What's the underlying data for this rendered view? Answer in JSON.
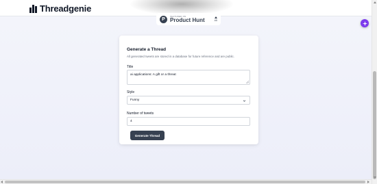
{
  "header": {
    "brand_name": "Threadgenie",
    "brand_icon": "bars-logo-icon"
  },
  "product_hunt_badge": {
    "small_text": "FEATURED ON",
    "name": "Product Hunt",
    "logo_letter": "P",
    "votes": "40",
    "icon": "upvote-arrow-icon"
  },
  "floating_button": {
    "icon": "sparkle-icon",
    "color": "#7c3aed"
  },
  "form": {
    "title": "Generate a Thread",
    "description": "All generated tweets are stored in a database for future reference and are public.",
    "title_label": "Title",
    "title_value": "ai applications: A gift or a threat",
    "style_label": "Style",
    "style_value": "Funny",
    "tweets_label": "Number of tweets",
    "tweets_value": "4",
    "submit_label": "Generate Thread"
  },
  "colors": {
    "accent": "#7c3aed",
    "button": "#374151",
    "background": "#eceef9"
  }
}
